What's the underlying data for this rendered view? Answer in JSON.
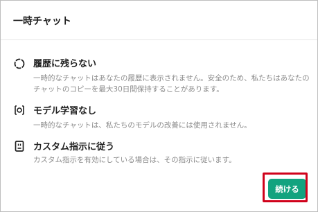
{
  "dialog": {
    "title": "一時チャット"
  },
  "sections": [
    {
      "icon": "dashed-circle-icon",
      "title": "履歴に残らない",
      "description": "一時的なチャットはあなたの履歴に表示されません。安全のため、私たちはあなたのチャットのコピーを最大30日間保持することがあります。"
    },
    {
      "icon": "model-training-icon",
      "title": "モデル学習なし",
      "description": "一時的なチャットは、私たちのモデルの改善には使用されません。"
    },
    {
      "icon": "instructions-icon",
      "title": "カスタム指示に従う",
      "description": "カスタム指示を有効にしている場合は、その指示に従います。"
    }
  ],
  "footer": {
    "continue_label": "続ける"
  },
  "colors": {
    "accent": "#12a37f",
    "highlight": "#d0021b",
    "muted_text": "#8a8a8a"
  }
}
